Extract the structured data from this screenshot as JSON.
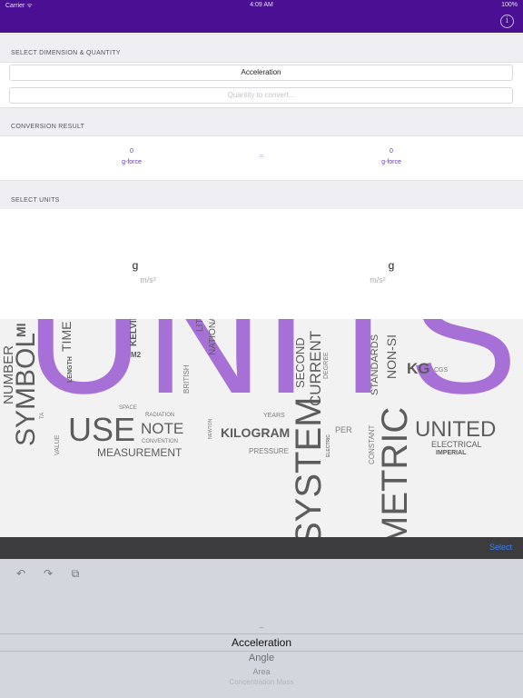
{
  "status_bar": {
    "carrier": "Carrier ᯤ",
    "time": "4:09 AM",
    "battery": "100%"
  },
  "header": {
    "info_icon": "info-icon",
    "info_label": "i"
  },
  "sections": {
    "dimension": "SELECT DIMENSION & QUANTITY",
    "result": "CONVERSION RESULT",
    "units": "SELECT UNITS"
  },
  "dimension": {
    "selected": "Acceleration",
    "quantity_placeholder": "Quantity to convert..."
  },
  "result": {
    "left_value": "0",
    "left_unit": "g-force",
    "equals": "=",
    "right_value": "0",
    "right_unit": "g-force"
  },
  "units": {
    "left_symbol": "g",
    "left_alt": "m/s²",
    "right_symbol": "g",
    "right_alt": "m/s²"
  },
  "cloud": {
    "big": [
      "U",
      "N",
      "I",
      "T",
      "S"
    ],
    "words": {
      "number": "NUMBER",
      "symbol": "SYMBOL",
      "mi": "MI",
      "time": "TIME",
      "length": "LENGTH",
      "kelvin": "KELVIN",
      "m2": "M2",
      "lit": "LIT",
      "national": "NATIONAL",
      "british": "BRITISH",
      "second": "SECOND",
      "current": "CURRENT",
      "degree": "DEGREE",
      "standards": "STANDARDS",
      "nonsi": "NON-SI",
      "kg": "KG",
      "cgs": "CGS",
      "space": "SPACE",
      "radiation": "RADIATION",
      "use": "USE",
      "note": "NOTE",
      "convention": "CONVENTION",
      "measurement": "MEASUREMENT",
      "value": "VALUE",
      "ta": "TA",
      "newton": "NEWTON",
      "years": "YEARS",
      "kilogram": "KILOGRAM",
      "per": "PER",
      "pressure": "PRESSURE",
      "system": "SYSTEM",
      "electric": "ELECTRIC",
      "constant": "CONSTANT",
      "metric": "METRIC",
      "united": "UNITED",
      "electrical": "ELECTRICAL",
      "imperial": "IMPERIAL"
    }
  },
  "toolbar": {
    "select_label": "Select"
  },
  "keyboard": {
    "undo_icon": "undo-icon",
    "redo_icon": "redo-icon",
    "paste_icon": "paste-icon"
  },
  "picker": {
    "above": "–",
    "selected": "Acceleration",
    "below": [
      "Angle",
      "Area",
      "Concentration Mass"
    ]
  },
  "colors": {
    "header": "#4a0f92",
    "accent": "#6b2fc9",
    "cloud_purple": "#a46ad6",
    "select_blue": "#3b7ff1"
  }
}
